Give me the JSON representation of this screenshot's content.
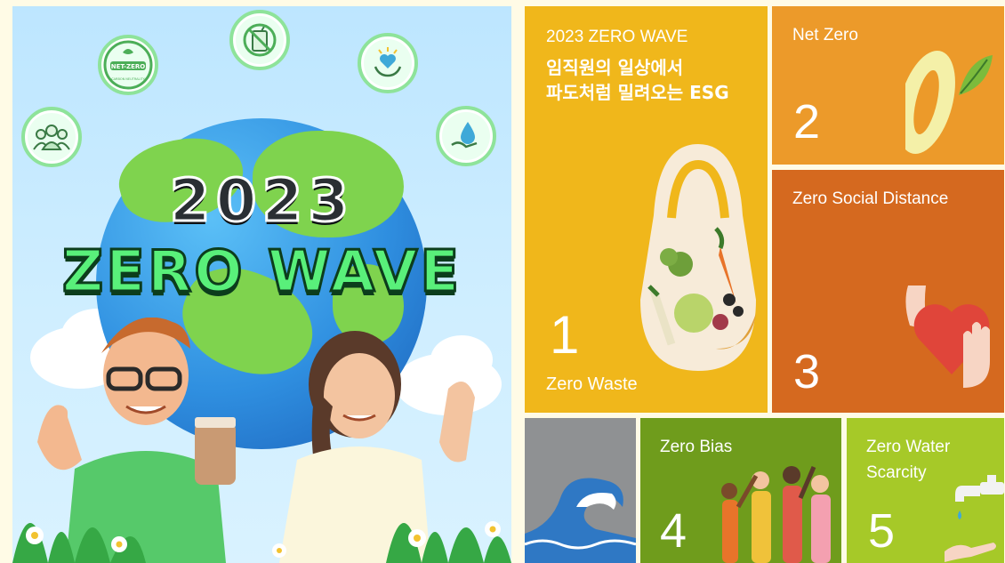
{
  "poster": {
    "year": "2023",
    "title": "ZERO WAVE",
    "badge_text": "NET-ZERO",
    "badge_subtext": "CARBON NEUTRALITY"
  },
  "tiles": {
    "t1": {
      "header": "2023 ZERO WAVE",
      "headline_1": "임직원의 일상에서",
      "headline_2": "파도처럼 밀려오는 ESG",
      "number": "1",
      "label": "Zero Waste",
      "color": "#f0b71b"
    },
    "t2": {
      "label": "Net Zero",
      "number": "2",
      "color": "#ec9a2a"
    },
    "t3": {
      "label": "Zero Social Distance",
      "number": "3",
      "color": "#d5691f"
    },
    "t4": {
      "label": "Zero Bias",
      "number": "4",
      "color": "#6f9c1c"
    },
    "t5": {
      "label_1": "Zero Water",
      "label_2": "Scarcity",
      "number": "5",
      "color": "#a6c928"
    },
    "wave": {
      "color": "#8f9193"
    }
  },
  "icons": [
    "cup-ban-icon",
    "net-zero-badge-icon",
    "hands-heart-icon",
    "people-icon",
    "water-drop-hand-icon",
    "shopping-bag-vegetables-icon",
    "zero-leaf-icon",
    "hand-heart-icon",
    "wave-icon",
    "diverse-people-icon",
    "faucet-icon"
  ]
}
